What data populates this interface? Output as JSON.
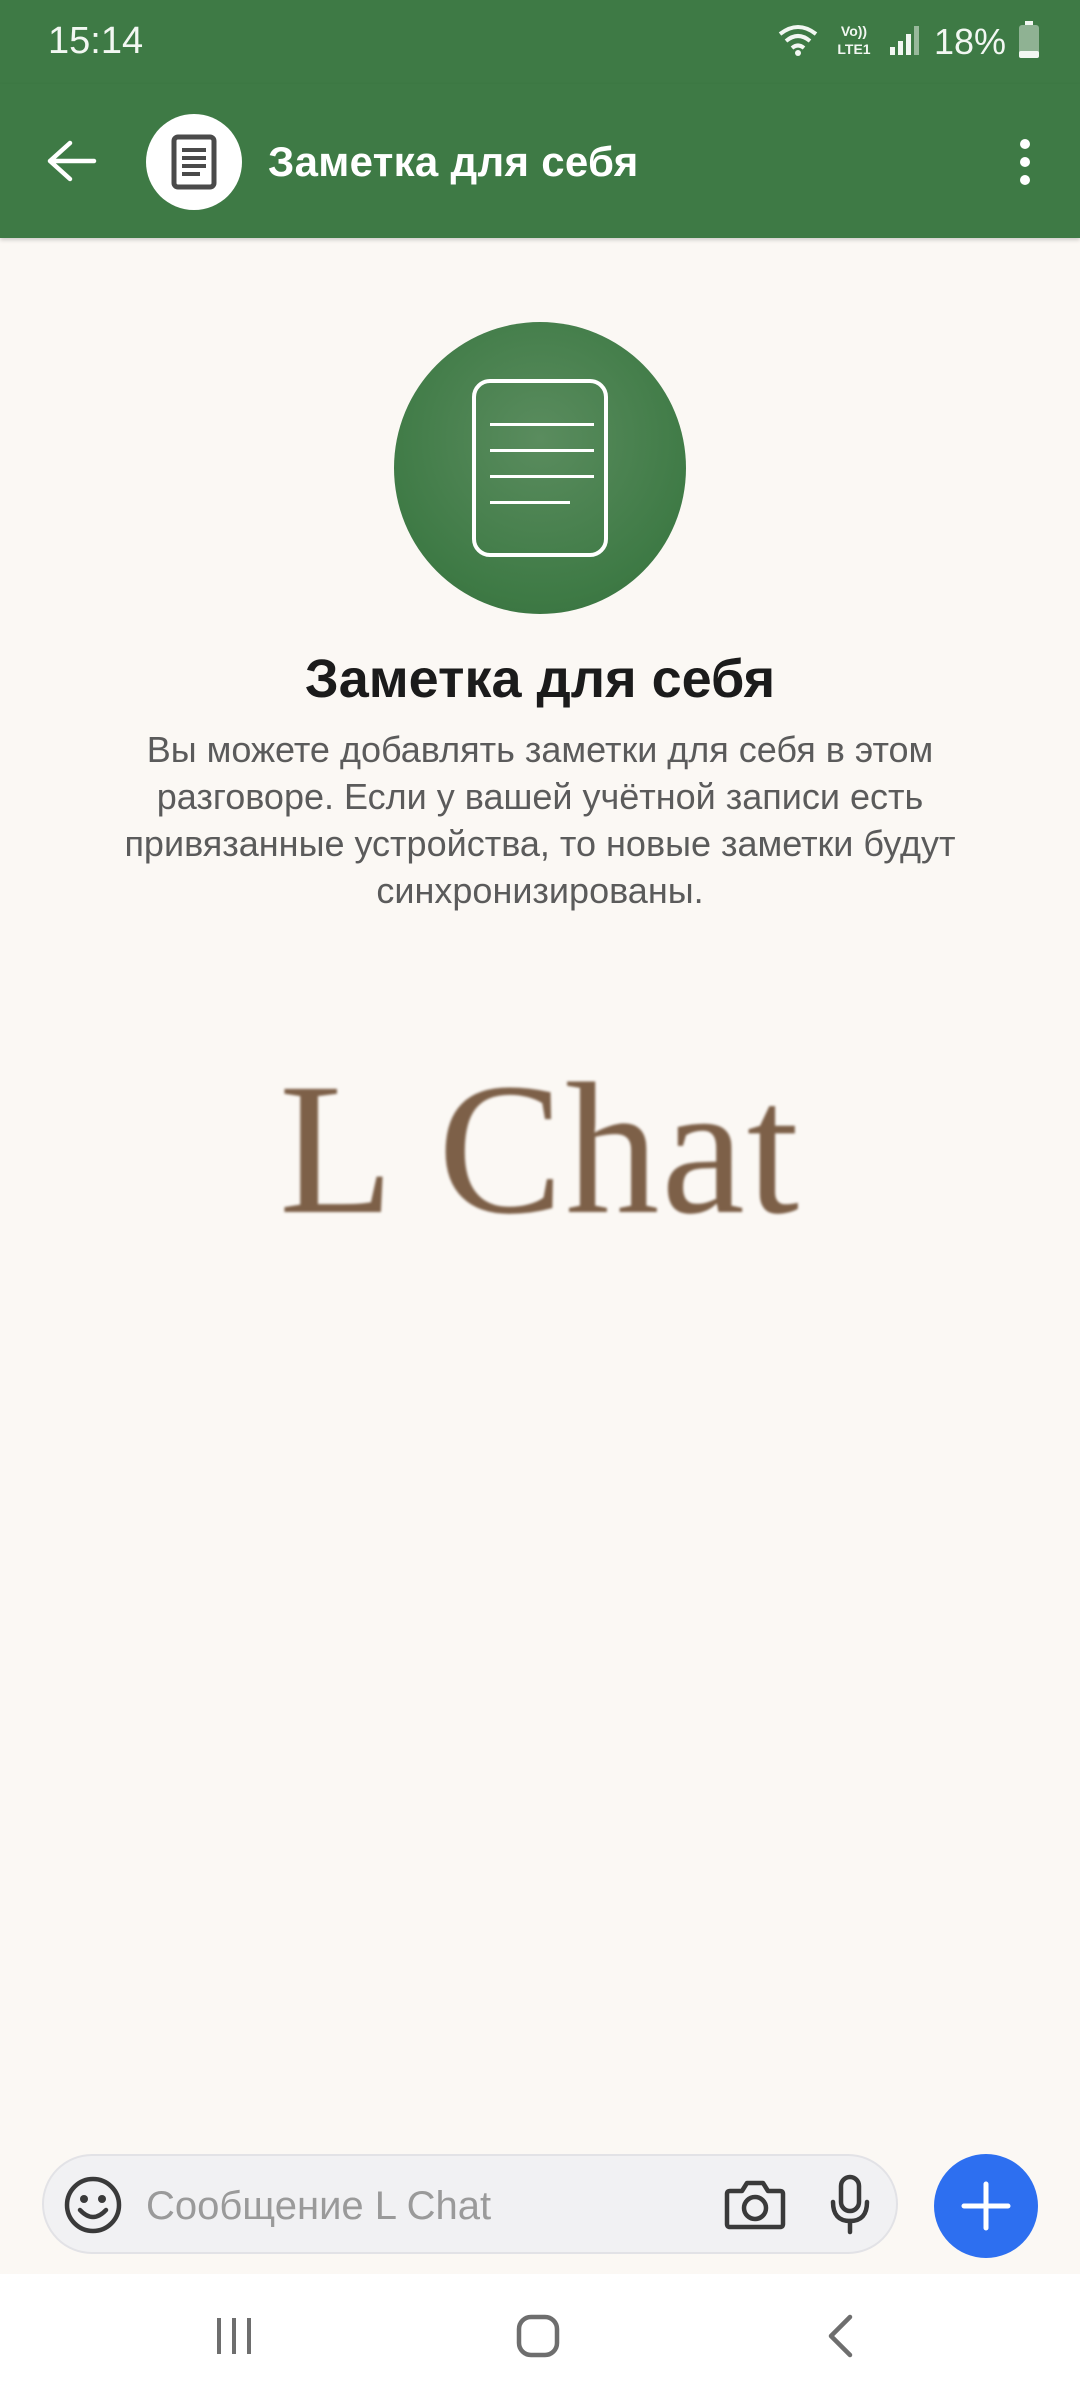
{
  "status_bar": {
    "time": "15:14",
    "network_label": "Vo)) LTE1",
    "battery": "18%"
  },
  "app_bar": {
    "title": "Заметка для себя",
    "avatar_icon": "note-document-icon",
    "back_icon": "arrow-back-icon",
    "menu_icon": "more-vertical-icon"
  },
  "hero": {
    "title": "Заметка для себя",
    "description": "Вы можете добавлять заметки для себя в этом разговоре. Если у вашей учётной записи есть привязанные устройства, то новые заметки будут синхронизированы."
  },
  "brand": {
    "logo_text": "L Chat"
  },
  "composer": {
    "placeholder": "Сообщение L Chat",
    "value": "",
    "emoji_icon": "emoji-icon",
    "camera_icon": "camera-icon",
    "mic_icon": "microphone-icon",
    "add_icon": "plus-icon"
  },
  "system_nav": {
    "recents_icon": "recent-apps-icon",
    "home_icon": "home-icon",
    "back_icon": "back-chevron-icon"
  },
  "colors": {
    "header": "#3e7a45",
    "background": "#fbf8f4",
    "accent_button": "#2d6ff0",
    "logo": "#7d6048"
  }
}
